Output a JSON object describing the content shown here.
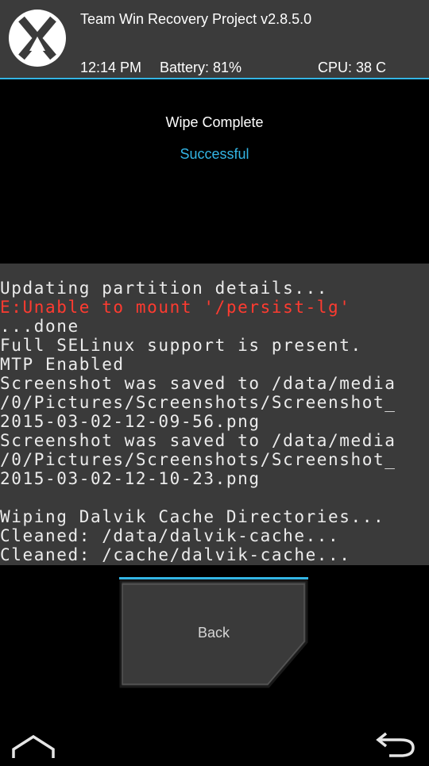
{
  "header": {
    "title": "Team Win Recovery Project  v2.8.5.0",
    "time": "12:14 PM",
    "battery": "Battery: 81%",
    "cpu": "CPU: 38 C",
    "logo_icon": "twrp-logo-icon",
    "accent_color": "#33b5e5"
  },
  "result": {
    "title": "Wipe Complete",
    "status": "Successful"
  },
  "console": {
    "lines": [
      {
        "text": "Updating partition details...",
        "type": "normal"
      },
      {
        "text": "E:Unable to mount '/persist-lg'",
        "type": "error"
      },
      {
        "text": "...done",
        "type": "normal"
      },
      {
        "text": "Full SELinux support is present.",
        "type": "normal"
      },
      {
        "text": "MTP Enabled",
        "type": "normal"
      },
      {
        "text": "Screenshot was saved to /data/media",
        "type": "normal"
      },
      {
        "text": "/0/Pictures/Screenshots/Screenshot_",
        "type": "normal"
      },
      {
        "text": "2015-03-02-12-09-56.png",
        "type": "normal"
      },
      {
        "text": "Screenshot was saved to /data/media",
        "type": "normal"
      },
      {
        "text": "/0/Pictures/Screenshots/Screenshot_",
        "type": "normal"
      },
      {
        "text": "2015-03-02-12-10-23.png",
        "type": "normal"
      },
      {
        "text": "",
        "type": "normal"
      },
      {
        "text": "Wiping Dalvik Cache Directories...",
        "type": "normal"
      },
      {
        "text": "Cleaned: /data/dalvik-cache...",
        "type": "normal"
      },
      {
        "text": "Cleaned: /cache/dalvik-cache...",
        "type": "normal"
      }
    ],
    "error_color": "#ff3b30"
  },
  "buttons": {
    "back_label": "Back"
  },
  "nav": {
    "home_icon": "home-icon",
    "back_icon": "back-arrow-icon"
  }
}
